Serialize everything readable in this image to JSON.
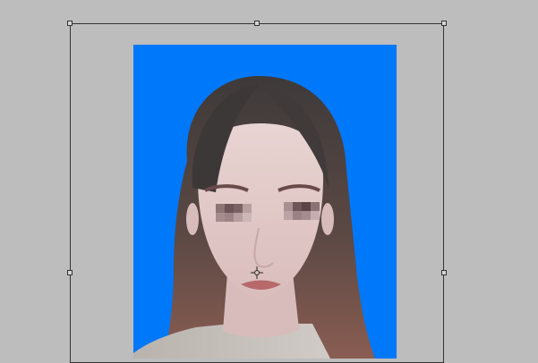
{
  "canvas": {
    "background_color": "#bdbdbd"
  },
  "photo": {
    "background_color": "#0078fa",
    "subject": "portrait",
    "face_privacy": "eyes-pixelated"
  },
  "transform": {
    "handles": [
      "top-left",
      "top-middle",
      "top-right",
      "middle-left",
      "middle-right"
    ],
    "reference_point_icon": "crosshair-icon"
  }
}
